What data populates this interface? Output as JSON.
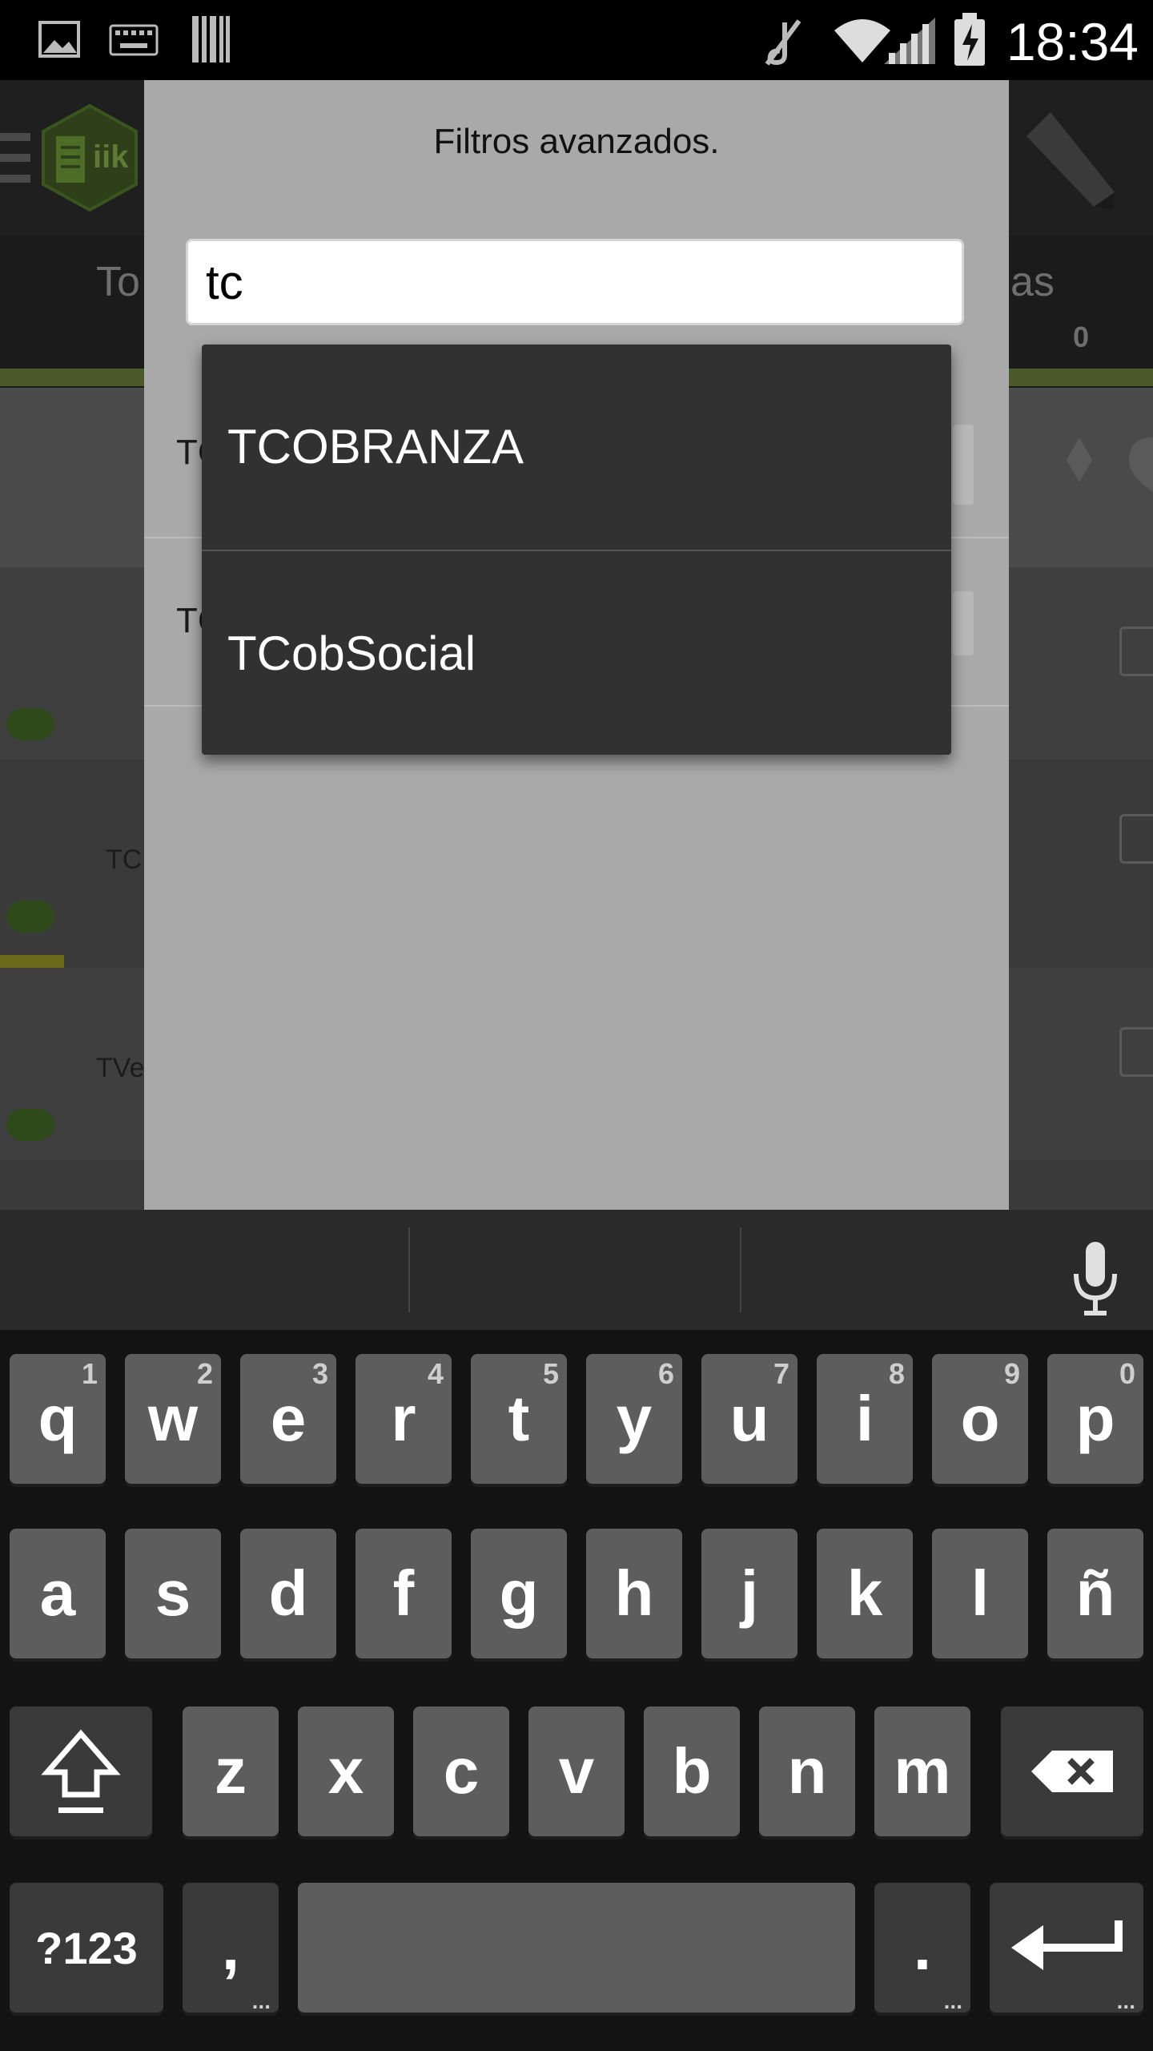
{
  "status_bar": {
    "time": "18:34",
    "icons": [
      "image-icon",
      "keyboard-icon",
      "barcode-icon",
      "mute-icon",
      "wifi-icon",
      "signal-icon",
      "battery-charging-icon"
    ]
  },
  "app": {
    "logo_text": "iik",
    "tabs": {
      "left_partial": "To",
      "right_partial": "as",
      "right_count": "0"
    },
    "list_rows": [
      {
        "partial_text": "TC"
      },
      {
        "partial_text": "TVe"
      }
    ]
  },
  "dialog": {
    "title": "Filtros avanzados.",
    "search": {
      "value": "tc",
      "placeholder": ""
    },
    "rows": [
      {
        "label_partial": "TC"
      },
      {
        "label_partial": "TC"
      }
    ]
  },
  "autocomplete": {
    "items": [
      "TCOBRANZA",
      "TCobSocial"
    ]
  },
  "keyboard": {
    "row1": [
      {
        "k": "q",
        "h": "1"
      },
      {
        "k": "w",
        "h": "2"
      },
      {
        "k": "e",
        "h": "3"
      },
      {
        "k": "r",
        "h": "4"
      },
      {
        "k": "t",
        "h": "5"
      },
      {
        "k": "y",
        "h": "6"
      },
      {
        "k": "u",
        "h": "7"
      },
      {
        "k": "i",
        "h": "8"
      },
      {
        "k": "o",
        "h": "9"
      },
      {
        "k": "p",
        "h": "0"
      }
    ],
    "row2": [
      "a",
      "s",
      "d",
      "f",
      "g",
      "h",
      "j",
      "k",
      "l",
      "ñ"
    ],
    "row3": [
      "z",
      "x",
      "c",
      "v",
      "b",
      "n",
      "m"
    ],
    "symbols_label": "?123",
    "comma_label": ",",
    "period_label": ".",
    "key_icons": [
      "shift-icon",
      "backspace-icon",
      "enter-icon",
      "microphone-icon"
    ]
  },
  "colors": {
    "accent_green": "#8ab83a",
    "dialog_bg": "#a9a9a9",
    "dropdown_bg": "#313131"
  }
}
